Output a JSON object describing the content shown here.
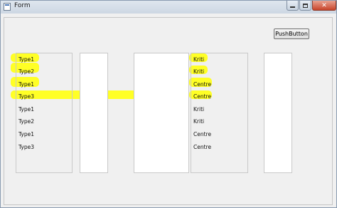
{
  "window": {
    "title": "Form",
    "icon": "form-window-icon",
    "controls": [
      "minimize-icon",
      "maximize-icon",
      "close-icon"
    ],
    "close_glyph": "✕"
  },
  "push_button": {
    "label": "PushButton"
  },
  "list_left": {
    "items": [
      "Type1",
      "Type2",
      "Type1",
      "Type3",
      "Type1",
      "Type2",
      "Type1",
      "Type3"
    ]
  },
  "list_right": {
    "items": [
      "Kriti",
      "Kriti",
      "Centre",
      "Centre",
      "Kriti",
      "Kriti",
      "Centre",
      "Centre"
    ]
  },
  "highlight": {
    "color": "#ffff1a",
    "highlighted_rows": 4
  }
}
